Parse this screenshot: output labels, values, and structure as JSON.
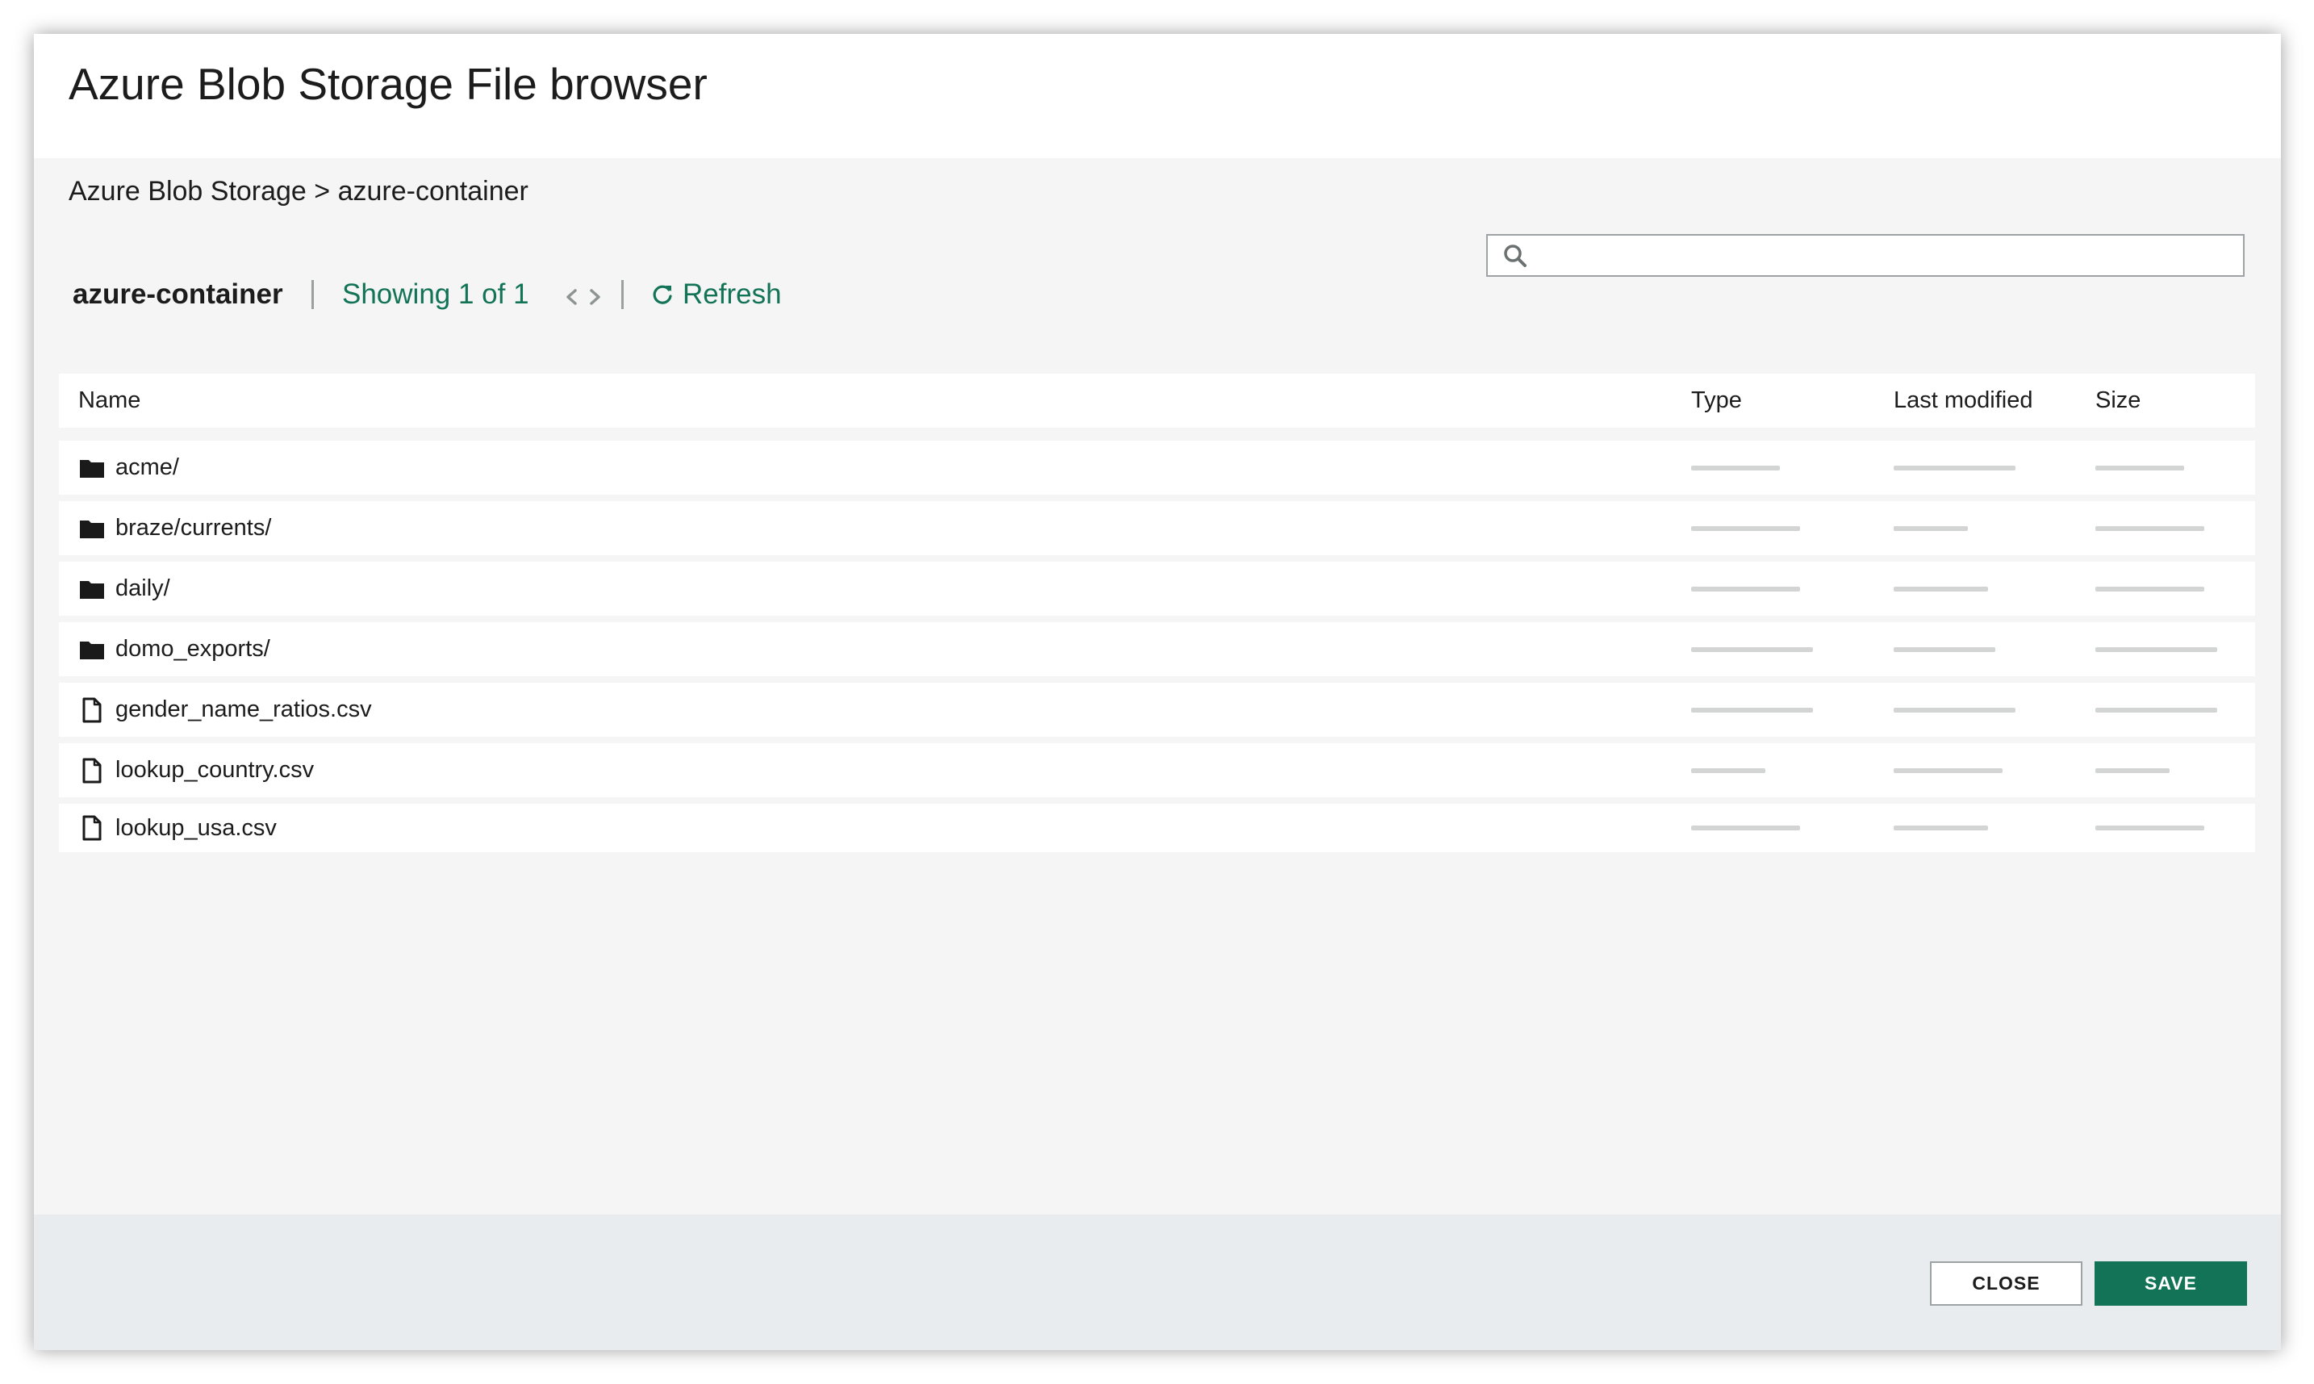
{
  "dialog": {
    "title": "Azure Blob Storage File browser"
  },
  "breadcrumb": {
    "root": "Azure Blob Storage",
    "separator": ">",
    "current": "azure-container"
  },
  "toolbar": {
    "container_name": "azure-container",
    "showing_text": "Showing 1 of 1",
    "prev_icon": "chevron-left-icon",
    "next_icon": "chevron-right-icon",
    "refresh_icon": "refresh-icon",
    "refresh_label": "Refresh"
  },
  "search": {
    "icon": "search-icon",
    "value": "",
    "placeholder": ""
  },
  "table": {
    "columns": {
      "name": "Name",
      "type": "Type",
      "last_modified": "Last modified",
      "size": "Size"
    },
    "rows": [
      {
        "name": "acme/",
        "kind": "folder"
      },
      {
        "name": "braze/currents/",
        "kind": "folder"
      },
      {
        "name": "daily/",
        "kind": "folder"
      },
      {
        "name": "domo_exports/",
        "kind": "folder"
      },
      {
        "name": "gender_name_ratios.csv",
        "kind": "file"
      },
      {
        "name": "lookup_country.csv",
        "kind": "file"
      },
      {
        "name": "lookup_usa.csv",
        "kind": "file"
      }
    ]
  },
  "footer": {
    "close_label": "CLOSE",
    "save_label": "SAVE"
  },
  "colors": {
    "accent": "#127356",
    "panel_bg": "#f4f5f4",
    "footer_bg": "#e8ecee",
    "placeholder_bar": "#d3d5d5"
  }
}
